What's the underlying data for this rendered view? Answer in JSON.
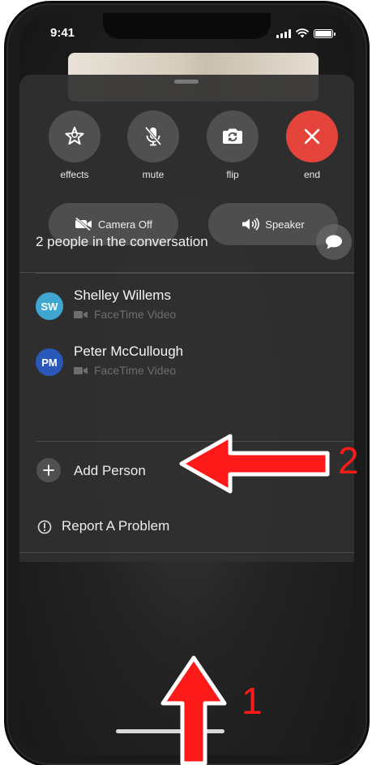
{
  "status_bar": {
    "time": "9:41"
  },
  "controls": {
    "effects_label": "effects",
    "mute_label": "mute",
    "flip_label": "flip",
    "end_label": "end",
    "end_color": "#e5443c"
  },
  "toggles": {
    "camera_label": "Camera Off",
    "speaker_label": "Speaker"
  },
  "conversation": {
    "count_text": "2 people in the conversation",
    "participants": [
      {
        "initials": "SW",
        "name": "Shelley Willems",
        "subtitle": "FaceTime Video",
        "avatar_color": "#3fa7cf"
      },
      {
        "initials": "PM",
        "name": "Peter McCullough",
        "subtitle": "FaceTime Video",
        "avatar_color": "#2a58b8"
      }
    ]
  },
  "actions": {
    "add_person": "Add Person",
    "report_problem": "Report A Problem"
  },
  "annotations": {
    "label_1": "1",
    "label_2": "2",
    "color": "#ff1a1a"
  }
}
